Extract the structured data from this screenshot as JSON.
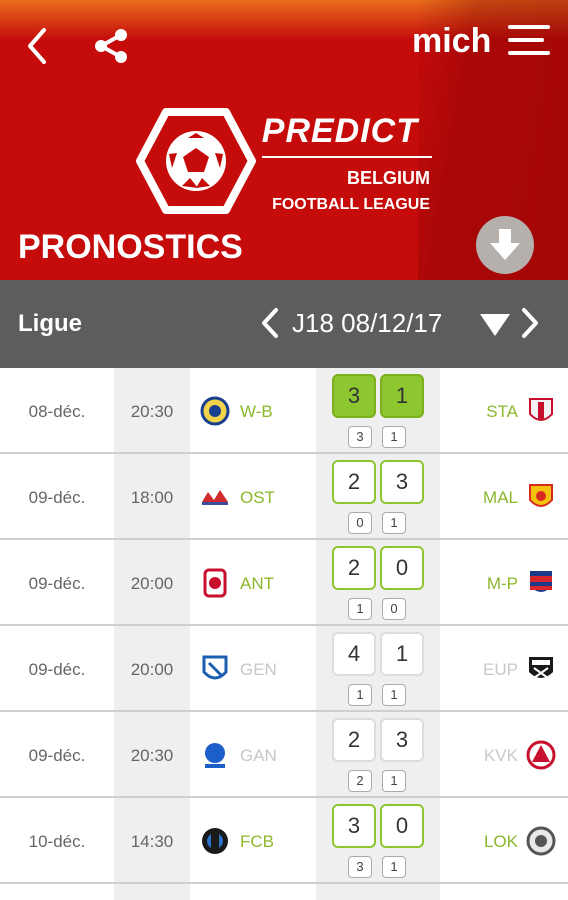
{
  "header": {
    "username": "mich",
    "brand_name": "PREDICT",
    "brand_country": "BELGIUM",
    "brand_league": "FOOTBALL LEAGUE",
    "page_title": "PRONOSTICS",
    "colors": {
      "primary": "#c60b0b",
      "top_gradient": "#e96d1b"
    }
  },
  "icons": {
    "back": "back-arrow-icon",
    "share": "share-icon",
    "menu": "hamburger-menu-icon",
    "download": "download-arrow-icon",
    "logo": "football-hexagon-logo"
  },
  "subbar": {
    "league_label": "Ligue",
    "round_label": "J18 08/12/17"
  },
  "colors": {
    "accent_green": "#8ec630",
    "team_green": "#8cb82b",
    "subbar": "#5d5d5d"
  },
  "matches": [
    {
      "date": "08-déc.",
      "time": "20:30",
      "home": "W-B",
      "away": "STA",
      "pred_home": "3",
      "pred_away": "1",
      "actual_home": "3",
      "actual_away": "1",
      "status": "exact"
    },
    {
      "date": "09-déc.",
      "time": "18:00",
      "home": "OST",
      "away": "MAL",
      "pred_home": "2",
      "pred_away": "3",
      "actual_home": "0",
      "actual_away": "1",
      "status": "winner"
    },
    {
      "date": "09-déc.",
      "time": "20:00",
      "home": "ANT",
      "away": "M-P",
      "pred_home": "2",
      "pred_away": "0",
      "actual_home": "1",
      "actual_away": "0",
      "status": "winner"
    },
    {
      "date": "09-déc.",
      "time": "20:00",
      "home": "GEN",
      "away": "EUP",
      "pred_home": "4",
      "pred_away": "1",
      "actual_home": "1",
      "actual_away": "1",
      "status": "wrong"
    },
    {
      "date": "09-déc.",
      "time": "20:30",
      "home": "GAN",
      "away": "KVK",
      "pred_home": "2",
      "pred_away": "3",
      "actual_home": "2",
      "actual_away": "1",
      "status": "wrong"
    },
    {
      "date": "10-déc.",
      "time": "14:30",
      "home": "FCB",
      "away": "LOK",
      "pred_home": "3",
      "pred_away": "0",
      "actual_home": "3",
      "actual_away": "1",
      "status": "winner"
    }
  ]
}
